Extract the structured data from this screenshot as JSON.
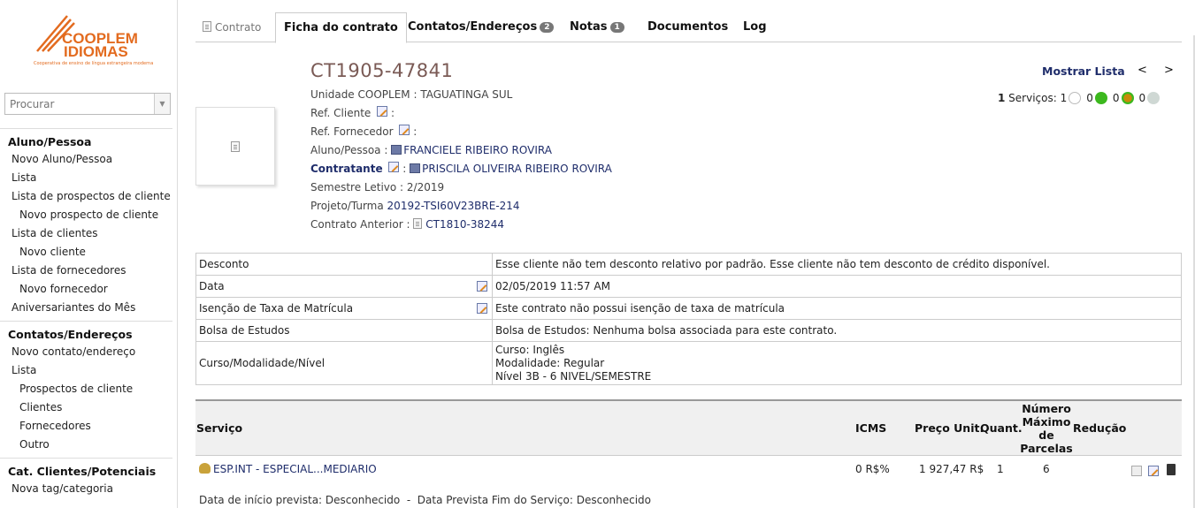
{
  "logo": {
    "line1": "COOPLEM",
    "line2": "IDIOMAS",
    "tagline": "Cooperativa de ensino de língua estrangeira moderna",
    "color": "#e36b1f"
  },
  "search": {
    "placeholder": "Procurar"
  },
  "sidebar": {
    "sections": [
      {
        "title": "Aluno/Pessoa",
        "items": [
          {
            "label": "Novo Aluno/Pessoa",
            "sub": false
          },
          {
            "label": "Lista",
            "sub": false
          },
          {
            "label": "Lista de prospectos de cliente",
            "sub": false
          },
          {
            "label": "Novo prospecto de cliente",
            "sub": true
          },
          {
            "label": "Lista de clientes",
            "sub": false
          },
          {
            "label": "Novo cliente",
            "sub": true
          },
          {
            "label": "Lista de fornecedores",
            "sub": false
          },
          {
            "label": "Novo fornecedor",
            "sub": true
          },
          {
            "label": "Aniversariantes do Mês",
            "sub": false
          }
        ]
      },
      {
        "title": "Contatos/Endereços",
        "items": [
          {
            "label": "Novo contato/endereço",
            "sub": false
          },
          {
            "label": "Lista",
            "sub": false
          },
          {
            "label": "Prospectos de cliente",
            "sub": true
          },
          {
            "label": "Clientes",
            "sub": true
          },
          {
            "label": "Fornecedores",
            "sub": true
          },
          {
            "label": "Outro",
            "sub": true
          }
        ]
      },
      {
        "title": "Cat. Clientes/Potenciais",
        "items": [
          {
            "label": "Nova tag/categoria",
            "sub": false
          }
        ]
      }
    ]
  },
  "tabs": {
    "contrato": "Contrato",
    "ficha": "Ficha do contrato",
    "contatos": "Contatos/Endereços",
    "contatos_count": "2",
    "notas": "Notas",
    "notas_count": "1",
    "documentos": "Documentos",
    "log": "Log"
  },
  "contract": {
    "number": "CT1905-47841",
    "unidade_label": "Unidade COOPLEM : ",
    "unidade": "TAGUATINGA SUL",
    "ref_cliente_label": "Ref. Cliente",
    "ref_fornecedor_label": "Ref. Fornecedor",
    "aluno_label": "Aluno/Pessoa : ",
    "aluno": "FRANCIELE RIBEIRO ROVIRA",
    "contratante_label": "Contratante",
    "contratante": "PRISCILA OLIVEIRA RIBEIRO ROVIRA",
    "semestre_label": "Semestre Letivo : ",
    "semestre": "2/2019",
    "projeto_label": "Projeto/Turma ",
    "projeto": "20192-TSI60V23BRE-214",
    "anterior_label": "Contrato Anterior : ",
    "anterior": "CT1810-38244"
  },
  "nav": {
    "mostrar_lista": "Mostrar Lista",
    "prev": "<",
    "next": ">"
  },
  "services_status": {
    "count": "1",
    "label": " Serviços: ",
    "values": [
      "1",
      "0",
      "0",
      "0"
    ],
    "colors": [
      "#ffffff",
      "#3cb81e",
      "#c98a0a",
      "#cfd8d4"
    ]
  },
  "details": [
    {
      "label": "Desconto",
      "value": "Esse cliente não tem desconto relativo por padrão. Esse cliente não tem desconto de crédito disponível.",
      "editable": false
    },
    {
      "label": "Data",
      "value": "02/05/2019 11:57 AM",
      "editable": true
    },
    {
      "label": "Isenção de Taxa de Matrícula",
      "value": "Este contrato não possui isenção de taxa de matrícula",
      "editable": true
    },
    {
      "label": "Bolsa de Estudos",
      "value": "Bolsa de Estudos: Nenhuma bolsa associada para este contrato.",
      "editable": false
    },
    {
      "label": "Curso/Modalidade/Nível",
      "value_lines": [
        "Curso: Inglês",
        "Modalidade: Regular",
        "Nível 3B - 6 NIVEL/SEMESTRE"
      ],
      "editable": false
    }
  ],
  "services_table": {
    "headers": {
      "servico": "Serviço",
      "icms": "ICMS",
      "preco": "Preço Unit.",
      "quant": "Quant.",
      "parcelas": [
        "Número",
        "Máximo",
        "de",
        "Parcelas"
      ],
      "reducao": "Redução"
    },
    "row": {
      "servico": "ESP.INT - ESPECIAL...MEDIARIO",
      "icms": "0 R$%",
      "preco": "1 927,47 R$",
      "quant": "1",
      "parcelas": "6"
    },
    "sub": "Data de início prevista: Desconhecido  -  Data Prevista Fim do Serviço: Desconhecido"
  }
}
